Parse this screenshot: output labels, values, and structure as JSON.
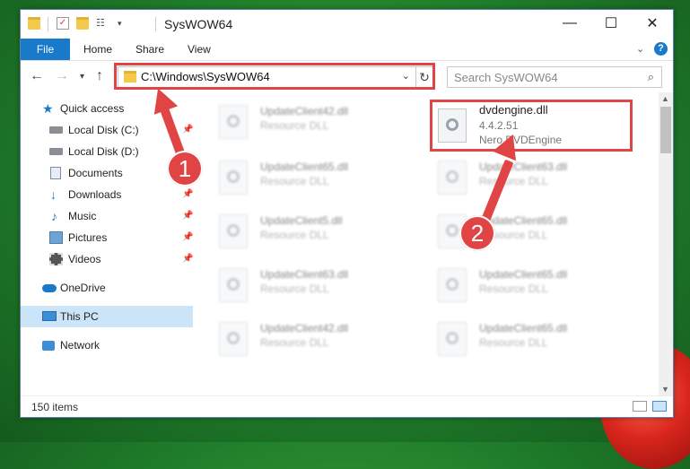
{
  "window": {
    "title": "SysWOW64"
  },
  "ribbon": {
    "tabs": [
      "File",
      "Home",
      "Share",
      "View"
    ]
  },
  "navigation": {
    "address": "C:\\Windows\\SysWOW64",
    "search_placeholder": "Search SysWOW64"
  },
  "sidebar": {
    "items": [
      {
        "label": "Quick access",
        "icon": "star-icon",
        "pinned": false
      },
      {
        "label": "Local Disk (C:)",
        "icon": "drive-icon",
        "pinned": true
      },
      {
        "label": "Local Disk (D:)",
        "icon": "drive-icon",
        "pinned": false
      },
      {
        "label": "Documents",
        "icon": "documents-icon",
        "pinned": true
      },
      {
        "label": "Downloads",
        "icon": "downloads-icon",
        "pinned": true
      },
      {
        "label": "Music",
        "icon": "music-icon",
        "pinned": true
      },
      {
        "label": "Pictures",
        "icon": "pictures-icon",
        "pinned": true
      },
      {
        "label": "Videos",
        "icon": "videos-icon",
        "pinned": true
      },
      {
        "label": "OneDrive",
        "icon": "onedrive-icon",
        "pinned": false
      },
      {
        "label": "This PC",
        "icon": "pc-icon",
        "pinned": false,
        "selected": true
      },
      {
        "label": "Network",
        "icon": "network-icon",
        "pinned": false
      }
    ]
  },
  "files": {
    "highlighted": {
      "name": "dvdengine.dll",
      "version": "4.4.2.51",
      "company": "Nero DVDEngine"
    },
    "left_column": [
      {
        "name": "UpdateClient42.dll",
        "desc": "Resource DLL"
      },
      {
        "name": "UpdateClient65.dll",
        "desc": "Resource DLL"
      },
      {
        "name": "UpdateClient5.dll",
        "desc": "Resource DLL"
      },
      {
        "name": "UpdateClient63.dll",
        "desc": "Resource DLL"
      },
      {
        "name": "UpdateClient42.dll",
        "desc": "Resource DLL"
      }
    ],
    "right_column": [
      {
        "name": "UpdateClient63.dll",
        "desc": "Resource DLL"
      },
      {
        "name": "UpdateClient65.dll",
        "desc": "Resource DLL"
      },
      {
        "name": "UpdateClient65.dll",
        "desc": "Resource DLL"
      },
      {
        "name": "UpdateClient65.dll",
        "desc": "Resource DLL"
      }
    ]
  },
  "status": {
    "item_count": "150 items"
  },
  "annotations": {
    "step1": "1",
    "step2": "2",
    "color": "#e04444"
  }
}
